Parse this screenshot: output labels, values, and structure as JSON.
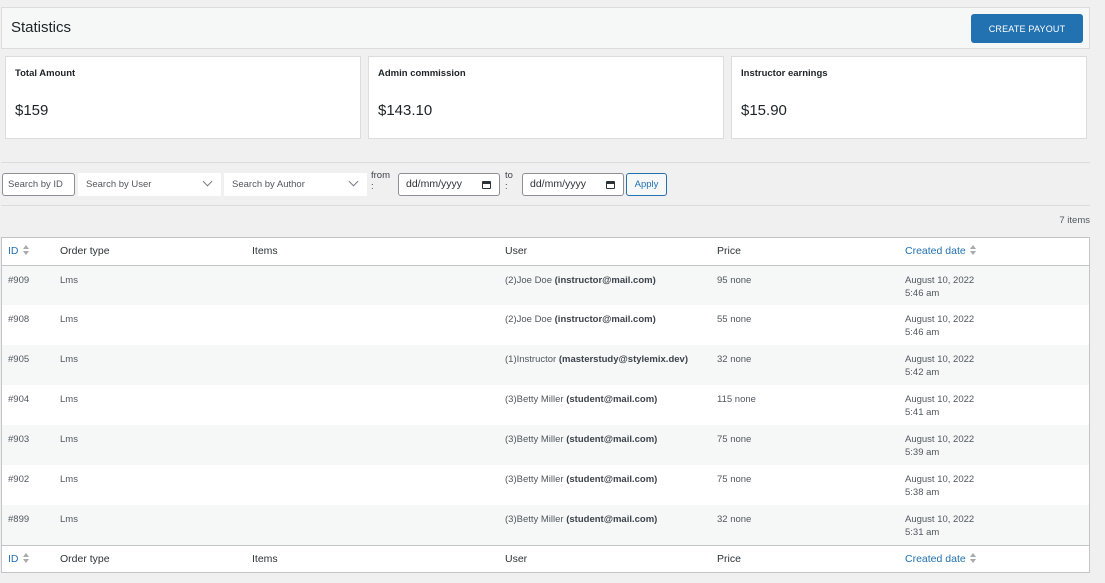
{
  "header": {
    "title": "Statistics",
    "create_payout_label": "CREATE PAYOUT"
  },
  "stats": [
    {
      "label": "Total Amount",
      "value": "$159"
    },
    {
      "label": "Admin commission",
      "value": "$143.10"
    },
    {
      "label": "Instructor earnings",
      "value": "$15.90"
    }
  ],
  "filters": {
    "search_id_placeholder": "Search by ID",
    "search_user_placeholder": "Search by User",
    "search_author_placeholder": "Search by Author",
    "from_label": "from :",
    "to_label": "to :",
    "from_date_placeholder": "dd/mm/yyyy",
    "to_date_placeholder": "dd/mm/yyyy",
    "apply_label": "Apply"
  },
  "items_count": "7 items",
  "table": {
    "columns": [
      "ID",
      "Order type",
      "Items",
      "User",
      "Price",
      "Created date"
    ],
    "rows": [
      {
        "id": "#909",
        "type": "Lms",
        "items": "",
        "user_name": "(2)Joe Doe",
        "user_email": "(instructor@mail.com)",
        "price": "95 none",
        "date": "August 10, 2022",
        "time": "5:46 am"
      },
      {
        "id": "#908",
        "type": "Lms",
        "items": "",
        "user_name": "(2)Joe Doe",
        "user_email": "(instructor@mail.com)",
        "price": "55 none",
        "date": "August 10, 2022",
        "time": "5:46 am"
      },
      {
        "id": "#905",
        "type": "Lms",
        "items": "",
        "user_name": "(1)Instructor",
        "user_email": "(masterstudy@stylemix.dev)",
        "price": "32 none",
        "date": "August 10, 2022",
        "time": "5:42 am"
      },
      {
        "id": "#904",
        "type": "Lms",
        "items": "",
        "user_name": "(3)Betty Miller",
        "user_email": "(student@mail.com)",
        "price": "115 none",
        "date": "August 10, 2022",
        "time": "5:41 am"
      },
      {
        "id": "#903",
        "type": "Lms",
        "items": "",
        "user_name": "(3)Betty Miller",
        "user_email": "(student@mail.com)",
        "price": "75 none",
        "date": "August 10, 2022",
        "time": "5:39 am"
      },
      {
        "id": "#902",
        "type": "Lms",
        "items": "",
        "user_name": "(3)Betty Miller",
        "user_email": "(student@mail.com)",
        "price": "75 none",
        "date": "August 10, 2022",
        "time": "5:38 am"
      },
      {
        "id": "#899",
        "type": "Lms",
        "items": "",
        "user_name": "(3)Betty Miller",
        "user_email": "(student@mail.com)",
        "price": "32 none",
        "date": "August 10, 2022",
        "time": "5:31 am"
      }
    ]
  },
  "colors": {
    "accent": "#2271b1",
    "background": "#f0f0f1",
    "row_alt": "#f6f7f7"
  }
}
